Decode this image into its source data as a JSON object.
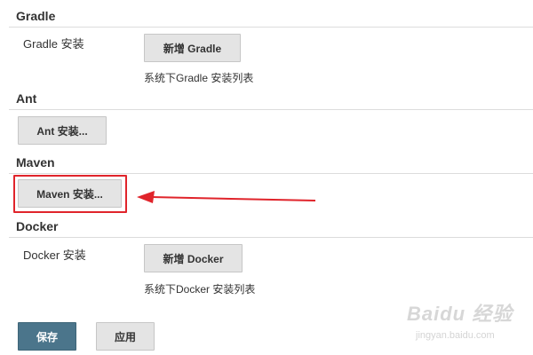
{
  "sections": {
    "gradle": {
      "title": "Gradle",
      "row_label": "Gradle 安装",
      "add_button": "新增 Gradle",
      "hint": "系统下Gradle 安装列表"
    },
    "ant": {
      "title": "Ant",
      "install_button": "Ant 安装..."
    },
    "maven": {
      "title": "Maven",
      "install_button": "Maven 安装..."
    },
    "docker": {
      "title": "Docker",
      "row_label": "Docker 安装",
      "add_button": "新增 Docker",
      "hint": "系统下Docker 安装列表"
    }
  },
  "actions": {
    "save": "保存",
    "apply": "应用"
  },
  "annotation": {
    "color": "#e0242b"
  },
  "watermark": {
    "logo": "Baidu 经验",
    "url": "jingyan.baidu.com"
  },
  "colors": {
    "primary_button": "#4b758b",
    "button_bg": "#e4e4e4",
    "divider": "#dcdcdc"
  }
}
